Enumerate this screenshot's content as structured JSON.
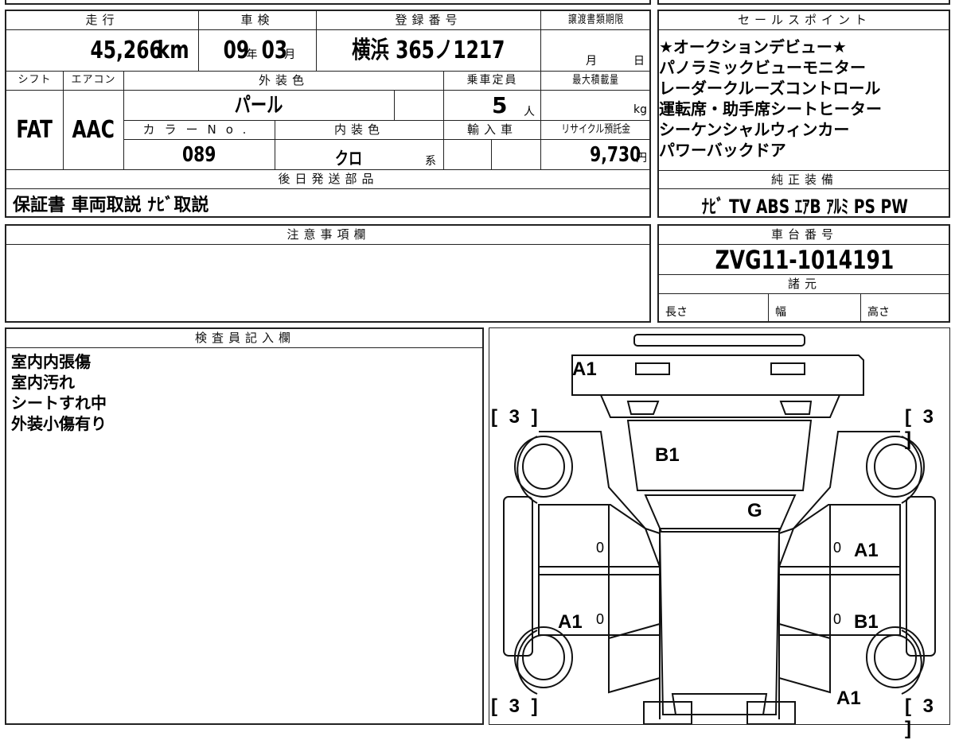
{
  "header_labels": {
    "mileage": "走行",
    "inspection": "車検",
    "registration": "登録番号",
    "transfer_deadline": "譲渡書類期限",
    "shift": "シフト",
    "aircon": "エアコン",
    "exterior_color": "外装色",
    "capacity": "乗車定員",
    "max_load": "最大積載量",
    "color_no": "カラーNo.",
    "interior_color": "内装色",
    "import": "輸入車",
    "recycle": "リサイクル預託金",
    "later_parts": "後日発送部品",
    "sales_points": "セールスポイント",
    "genuine_equipment": "純正装備",
    "notes": "注意事項欄",
    "chassis_no": "車台番号",
    "specs": "諸元",
    "inspector": "検査員記入欄"
  },
  "values": {
    "mileage": "45,266",
    "mileage_unit": "km",
    "inspection_year": "09",
    "year_unit": "年",
    "inspection_month": "03",
    "month_unit": "月",
    "registration": "横浜 365ノ1217",
    "deadline_month": "月",
    "deadline_day": "日",
    "shift": "FAT",
    "aircon": "AAC",
    "exterior_color": "パール",
    "capacity": "5",
    "capacity_unit": "人",
    "max_load_unit": "kg",
    "color_no": "089",
    "interior_color": "クロ",
    "interior_suffix": "系",
    "recycle": "9,730",
    "recycle_unit": "円",
    "later_parts": "保証書 車両取説 ﾅﾋﾞ取説",
    "chassis_no": "ZVG11-1014191",
    "spec_length": "長さ",
    "spec_width": "幅",
    "spec_height": "高さ"
  },
  "sales_points": [
    "★オークションデビュー★",
    "パノラミックビューモニター",
    "レーダークルーズコントロール",
    "運転席・助手席シートヒーター",
    "シーケンシャルウィンカー",
    "パワーバックドア"
  ],
  "genuine_equipment": "ﾅﾋﾞ TV ABS ｴｱB ｱﾙﾐ PS PW",
  "inspector_notes": [
    "室内内張傷",
    "室内汚れ",
    "シートすれ中",
    "外装小傷有り"
  ],
  "diagram_marks": {
    "front": "A1",
    "hood": "B1",
    "windshield": "G",
    "right_front_door": "A1",
    "left_rear_door": "A1",
    "right_rear_door": "B1",
    "rear": "A1",
    "tire_fl": "[ 3 ]",
    "tire_fr": "[ 3 ]",
    "tire_rl": "[ 3 ]",
    "tire_rr": "[ 3 ]",
    "zero": "0"
  }
}
